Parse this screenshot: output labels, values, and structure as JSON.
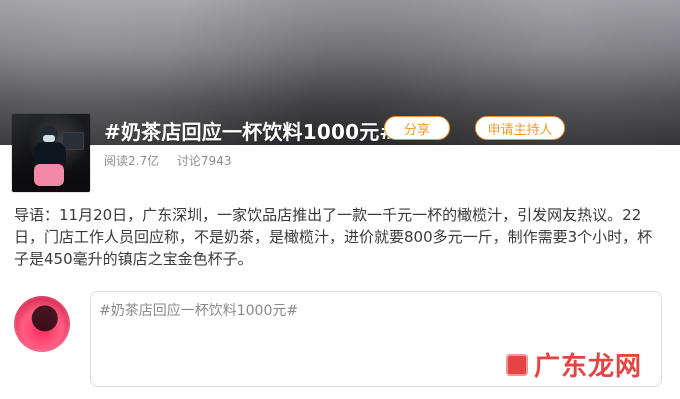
{
  "topic": {
    "title": "#奶茶店回应一杯饮料1000元#",
    "share_button": "分享",
    "host_button": "申请主持人",
    "stats": {
      "reads": "阅读2.7亿",
      "discussions": "讨论7943"
    },
    "intro": "导语：11月20日，广东深圳，一家饮品店推出了一款一千元一杯的橄榄汁，引发网友热议。22日，门店工作人员回应称，不是奶茶，是橄榄汁，进价就要800多元一斤，制作需要3个小时，杯子是450毫升的镇店之宝金色杯子。"
  },
  "composer": {
    "prefill": "#奶茶店回应一杯饮料1000元#"
  },
  "watermark": {
    "text": "广东龙网"
  },
  "colors": {
    "accent_orange": "#f09a32",
    "watermark_red": "#e43a3a"
  }
}
